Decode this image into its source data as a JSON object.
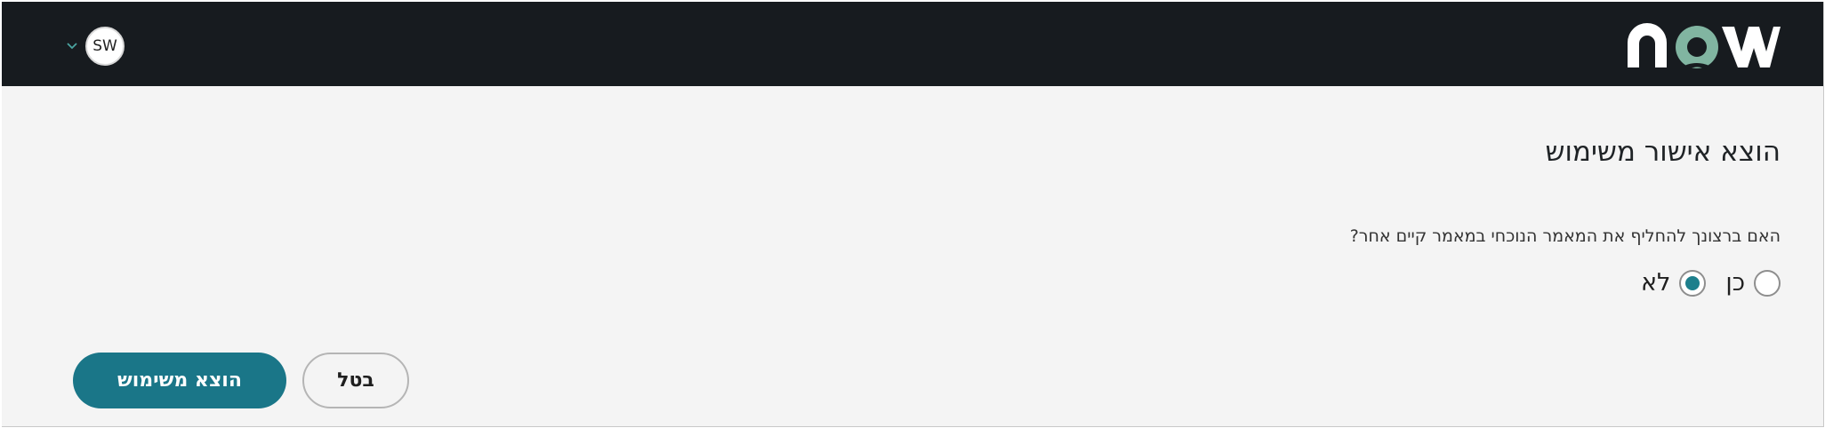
{
  "header": {
    "logo_text": "now",
    "user_initials": "SW",
    "accent_color": "#81b5a1"
  },
  "dialog": {
    "title": "הוצא אישור משימוש",
    "question": "האם ברצונך להחליף את המאמר הנוכחי במאמר קיים אחר?",
    "options": [
      {
        "label": "כן",
        "selected": false
      },
      {
        "label": "לא",
        "selected": true
      }
    ],
    "cancel_label": "בטל",
    "submit_label": "הוצא משימוש"
  },
  "colors": {
    "header_bg": "#171b1f",
    "primary": "#1a7688",
    "radio_selected": "#1d7f8c"
  }
}
